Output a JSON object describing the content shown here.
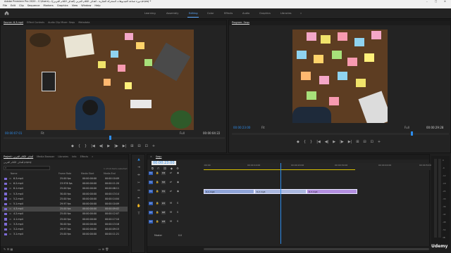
{
  "app": {
    "title": "Adobe Premiere Pro 2020 - C:\\Users\\...\\دورة صناعة الفيديوهات المتحركة التجارية - أهداف الكلام العربي (أهداف الكلام العربي).prproj *",
    "window_controls": [
      "–",
      "□",
      "✕"
    ]
  },
  "menu": [
    "File",
    "Edit",
    "Clip",
    "Sequence",
    "Markers",
    "Graphics",
    "View",
    "Window",
    "Help"
  ],
  "workspaces": {
    "home_icon": "home-icon",
    "items": [
      "Learning",
      "Assembly",
      "Editing",
      "Color",
      "Effects",
      "Audio",
      "Graphics",
      "Libraries"
    ],
    "active": "Editing",
    "more": "»"
  },
  "source_panel": {
    "tabs": [
      "Source: 6-3.mp4",
      "Effect Controls",
      "Audio Clip Mixer: Sequ",
      "Metadata"
    ],
    "timecode_left": "00:00:07:01",
    "zoom": "Fit",
    "quality": "Full",
    "timecode_right": "00:00:04:22",
    "transport": [
      "◆",
      "{",
      "}",
      "|◀",
      "◀|",
      "▶",
      "|▶",
      "▶|",
      "⊞",
      "⊟",
      "⊡",
      "+"
    ]
  },
  "program_panel": {
    "tabs": [
      "Program: Sequ"
    ],
    "timecode_left": "00:00:23:00",
    "zoom": "Fit",
    "quality": "Full",
    "timecode_right": "00:00:29:28",
    "transport": [
      "◆",
      "{",
      "}",
      "|◀",
      "◀|",
      "▶",
      "|▶",
      "▶|",
      "⊞",
      "⊟",
      "⊡",
      "+"
    ]
  },
  "project_panel": {
    "tabs": [
      "Project: أهداف الكلام العربي",
      "Media Browser",
      "Libraries",
      "Info",
      "Effects",
      "»"
    ],
    "breadcrumb": "أهداف الكلام العربي.prproj",
    "search_placeholder": "",
    "selection": "1 of 14 items selected",
    "columns": [
      "Name",
      "Frame Rate",
      "Media Start",
      "Media End"
    ],
    "rows": [
      {
        "name": "6-3.mp4",
        "fps": "25.00 fps",
        "start": "00:00:00:00",
        "end": "00:00:10:09"
      },
      {
        "name": "6-2.mp4",
        "fps": "23.976 fps",
        "start": "00:00:00:00",
        "end": "00:00:11:20"
      },
      {
        "name": "6-1.mp4",
        "fps": "25.00 fps",
        "start": "00:00:00:00",
        "end": "00:00:06:11"
      },
      {
        "name": "5-3.mp4",
        "fps": "30.00 fps",
        "start": "00:00:00:00",
        "end": "00:00:13:14"
      },
      {
        "name": "5-2.mp4",
        "fps": "25.00 fps",
        "start": "00:00:00:00",
        "end": "00:00:14:04"
      },
      {
        "name": "5-1.mp4",
        "fps": "29.97 fps",
        "start": "00:00:00:00",
        "end": "00:00:10:09"
      },
      {
        "name": "4-3.mp4",
        "fps": "25.00 fps",
        "start": "00:00:00:00",
        "end": "00:00:09:02"
      },
      {
        "name": "4-2.mp4",
        "fps": "25.00 fps",
        "start": "00:00:00:00",
        "end": "00:00:12:07"
      },
      {
        "name": "4-1.mp4",
        "fps": "25.00 fps",
        "start": "00:00:00:00",
        "end": "00:00:17:10"
      },
      {
        "name": "3-3.mp4",
        "fps": "30.00 fps",
        "start": "00:00:00:00",
        "end": "00:00:13:16"
      },
      {
        "name": "3-2.mp4",
        "fps": "29.97 fps",
        "start": "00:00:00:00",
        "end": "00:00:09:15"
      },
      {
        "name": "3-1.mp4",
        "fps": "25.00 fps",
        "start": "00:00:00:00",
        "end": "00:00:11:21"
      }
    ],
    "selected_index": 6
  },
  "timeline": {
    "tab": "Sequ",
    "timecode": "00:00:23:00",
    "ruler_ticks": [
      ":00:00",
      "00:00:10:00",
      "00:00:20:00",
      "00:00:30:00",
      "00:00:40:00",
      "00:00:50:00"
    ],
    "video_tracks": [
      "V3",
      "V2",
      "V1"
    ],
    "audio_tracks": [
      "A1",
      "A2",
      "A3"
    ],
    "master_label": "Master",
    "master_value": "0.0",
    "clips": [
      {
        "label": "6-1.mp4",
        "color": "#8fa4d8"
      },
      {
        "label": "6-2.mp4",
        "color": "#aab8e0"
      },
      {
        "label": "6-3.mp4",
        "color": "#b38fe0"
      }
    ],
    "playhead_fraction": 0.34
  },
  "meter_labels": [
    "0",
    "-6",
    "-12",
    "-18",
    "-24",
    "-30",
    "-36",
    "-42",
    "-48",
    "-54",
    "dB"
  ],
  "watermark": "Udemy",
  "colors": {
    "accent": "#2d8ceb",
    "active_workspace": "#5aa8ff"
  }
}
